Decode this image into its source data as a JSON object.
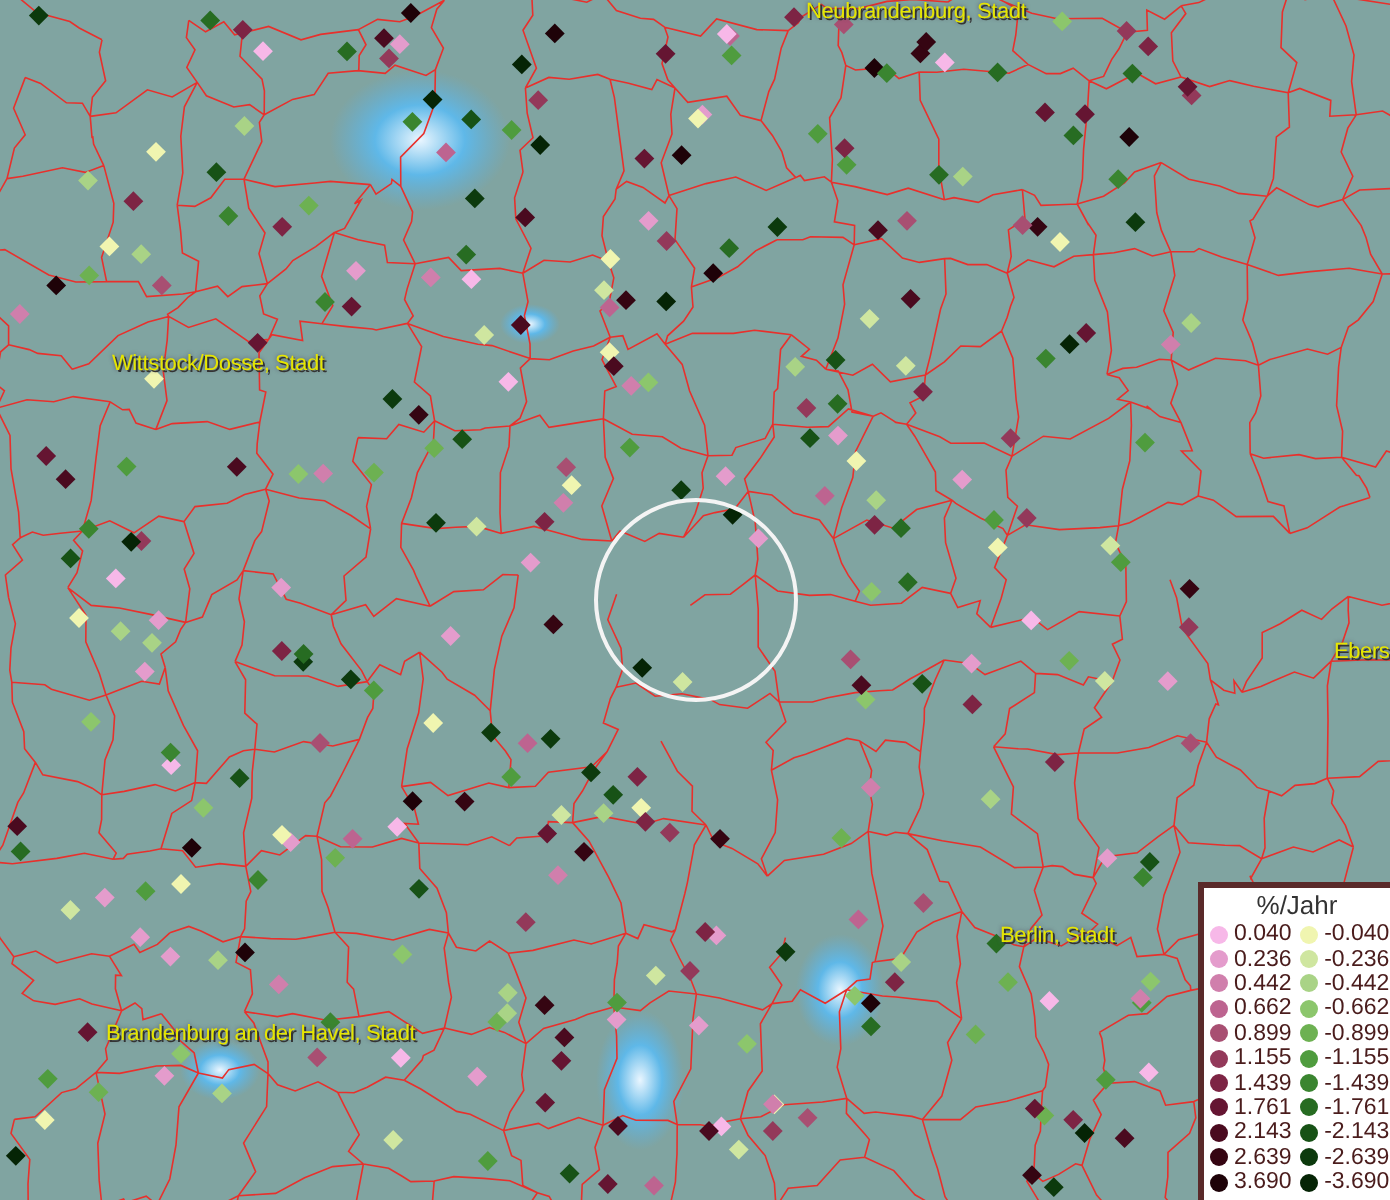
{
  "map": {
    "places": [
      {
        "name": "Neubrandenburg, Stadt"
      },
      {
        "name": "Wittstock/Dosse, Stadt"
      },
      {
        "name": "Ebers"
      },
      {
        "name": "Berlin, Stadt"
      },
      {
        "name": "Brandenburg an der Havel, Stadt"
      }
    ]
  },
  "legend": {
    "title": "%/Jahr",
    "positive": [
      {
        "value": "0.040",
        "color": "#f7b8e8"
      },
      {
        "value": "0.236",
        "color": "#e49ccc"
      },
      {
        "value": "0.442",
        "color": "#d07fac"
      },
      {
        "value": "0.662",
        "color": "#bd6490"
      },
      {
        "value": "0.899",
        "color": "#a84f72"
      },
      {
        "value": "1.155",
        "color": "#93395a"
      },
      {
        "value": "1.439",
        "color": "#7d2444"
      },
      {
        "value": "1.761",
        "color": "#651532"
      },
      {
        "value": "2.143",
        "color": "#4a0a1f"
      },
      {
        "value": "2.639",
        "color": "#350512"
      },
      {
        "value": "3.690",
        "color": "#1e0208"
      }
    ],
    "negative": [
      {
        "value": "-0.040",
        "color": "#f0f5b0"
      },
      {
        "value": "-0.236",
        "color": "#cfe6a0"
      },
      {
        "value": "-0.442",
        "color": "#a9d386"
      },
      {
        "value": "-0.662",
        "color": "#8cc66c"
      },
      {
        "value": "-0.899",
        "color": "#6db152"
      },
      {
        "value": "-1.155",
        "color": "#4f9c3e"
      },
      {
        "value": "-1.439",
        "color": "#3a8530"
      },
      {
        "value": "-1.761",
        "color": "#276c22"
      },
      {
        "value": "-2.143",
        "color": "#175216"
      },
      {
        "value": "-2.639",
        "color": "#0c3a0d"
      },
      {
        "value": "-3.690",
        "color": "#052405"
      }
    ]
  }
}
